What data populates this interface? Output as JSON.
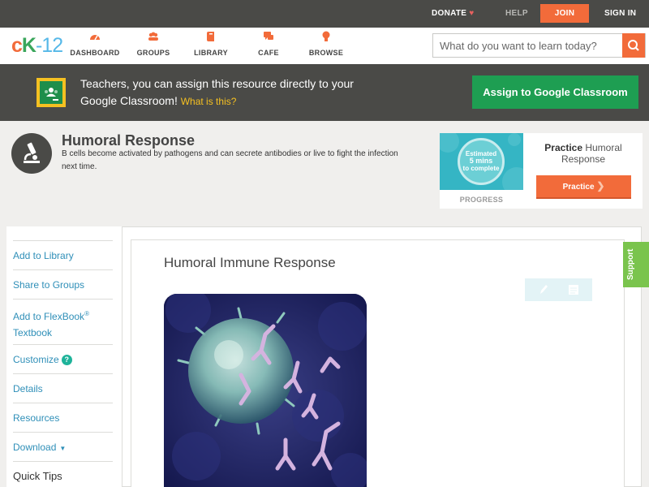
{
  "topbar": {
    "donate": "DONATE",
    "help": "HELP",
    "join": "JOIN",
    "sign_in": "SIGN IN"
  },
  "logo": {
    "c": "c",
    "k": "K",
    "d": "-12"
  },
  "nav": [
    {
      "label": "DASHBOARD",
      "icon": "dashboard-icon"
    },
    {
      "label": "GROUPS",
      "icon": "groups-icon"
    },
    {
      "label": "LIBRARY",
      "icon": "library-icon"
    },
    {
      "label": "CAFE",
      "icon": "cafe-icon"
    },
    {
      "label": "BROWSE",
      "icon": "browse-icon"
    }
  ],
  "search": {
    "placeholder": "What do you want to learn today?",
    "value": ""
  },
  "classroom_banner": {
    "text": "Teachers, you can assign this resource directly to your Google Classroom!",
    "what_link": "What is this?",
    "assign_button": "Assign to Google Classroom"
  },
  "concept": {
    "title": "Humoral Response",
    "description": "B cells become activated by pathogens and can secrete antibodies or live to fight the infection next time."
  },
  "practice": {
    "est_line1": "Estimated",
    "est_line2": "5 mins",
    "est_line3": "to complete",
    "progress_label": "PROGRESS",
    "title_bold": "Practice",
    "title_rest": "Humoral Response",
    "button": "Practice"
  },
  "sidebar": {
    "add_library": "Add to Library",
    "share_groups": "Share to Groups",
    "add_flexbook_1": "Add to FlexBook",
    "add_flexbook_reg": "®",
    "add_flexbook_2": "Textbook",
    "customize": "Customize",
    "customize_help": "?",
    "details": "Details",
    "resources": "Resources",
    "download": "Download",
    "download_caret": "▼",
    "quick_tips": "Quick Tips"
  },
  "article": {
    "title": "Humoral Immune Response"
  },
  "support": "Support",
  "colors": {
    "accent": "#f26b3a",
    "green": "#1e9e52",
    "link": "#2f8fb8",
    "dark": "#4a4a47"
  }
}
